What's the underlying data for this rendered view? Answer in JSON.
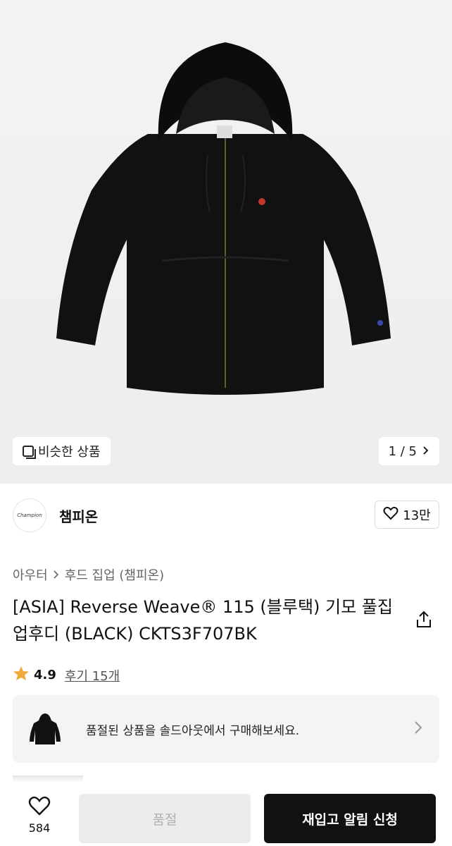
{
  "gallery": {
    "similar_label": "비슷한 상품",
    "pager_text": "1 / 5"
  },
  "brand": {
    "logo_text": "Champion",
    "name": "챔피온",
    "likes": "13만"
  },
  "breadcrumb": {
    "category": "아우터",
    "subcategory": "후드 집업 (챔피온)"
  },
  "product": {
    "title": "[ASIA] Reverse Weave® 115 (블루택) 기모 풀집업후디 (BLACK) CKTS3F707BK"
  },
  "rating": {
    "score": "4.9",
    "reviews": "후기 15개"
  },
  "soldout_banner": {
    "message": "품절된 상품을 솔드아웃에서 구매해보세요."
  },
  "bottom_bar": {
    "like_count": "584",
    "soldout_label": "품절",
    "restock_label": "재입고 알림 신청"
  },
  "colors": {
    "accent_star": "#f2a93b",
    "primary_button": "#111111"
  }
}
